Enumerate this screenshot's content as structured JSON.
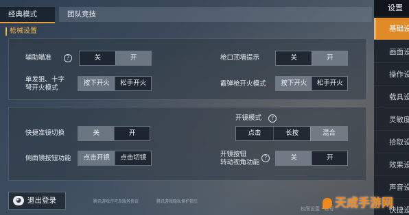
{
  "tabs": [
    {
      "label": "经典模式",
      "active": true
    },
    {
      "label": "团队竞技",
      "active": false
    }
  ],
  "section": {
    "title": "枪械设置"
  },
  "panel1": {
    "aim_assist": {
      "label": "辅助瞄准",
      "options": [
        "关",
        "开"
      ],
      "selected": "开"
    },
    "muzzle_hint": {
      "label": "枪口顶墙提示",
      "options": [
        "关",
        "开"
      ],
      "selected": "开"
    },
    "single_fire": {
      "label": "单发狙、十字\n弩开火模式",
      "options": [
        "按下开火",
        "松手开火"
      ],
      "selected": "按下开火"
    },
    "shotgun_fire": {
      "label": "霰弹枪开火模式",
      "options": [
        "按下开火",
        "松手开火"
      ],
      "selected": "按下开火"
    }
  },
  "panel2": {
    "scope_switch": {
      "label": "快捷准镜切换",
      "options": [
        "关",
        "开"
      ],
      "selected": "关"
    },
    "scope_mode": {
      "label": "开镜模式",
      "options": [
        "点击",
        "长按",
        "混合"
      ],
      "selected": "混合"
    },
    "side_scope": {
      "label": "侧面镜按钮功能",
      "options": [
        "点击开镜",
        "点击切镜"
      ],
      "selected": "点击开镜"
    },
    "scope_button_view": {
      "label": "开镜按钮\n转动视角功能",
      "options": [
        "关",
        "开"
      ],
      "selected": "开"
    }
  },
  "logout": {
    "label": "退出登录"
  },
  "footer_links": [
    "腾讯游戏许可及服务协议",
    "腾讯游戏隐私保护指引"
  ],
  "bottom_hint": "权限设置 · 帐号",
  "sidebar": {
    "title": "设置",
    "items": [
      {
        "label": "基础设置",
        "active": true
      },
      {
        "label": "画面设置",
        "active": false
      },
      {
        "label": "操作设置",
        "active": false
      },
      {
        "label": "载具设置",
        "active": false
      },
      {
        "label": "灵敏度",
        "active": false
      },
      {
        "label": "拾取设置",
        "active": false
      },
      {
        "label": "效果设置",
        "active": false
      },
      {
        "label": "声音设置",
        "active": false
      },
      {
        "label": "快捷设置",
        "active": false
      }
    ]
  },
  "watermark": {
    "text": "天成手游网"
  },
  "colors": {
    "accent": "#e08a28",
    "section_title": "#f0b04a"
  }
}
